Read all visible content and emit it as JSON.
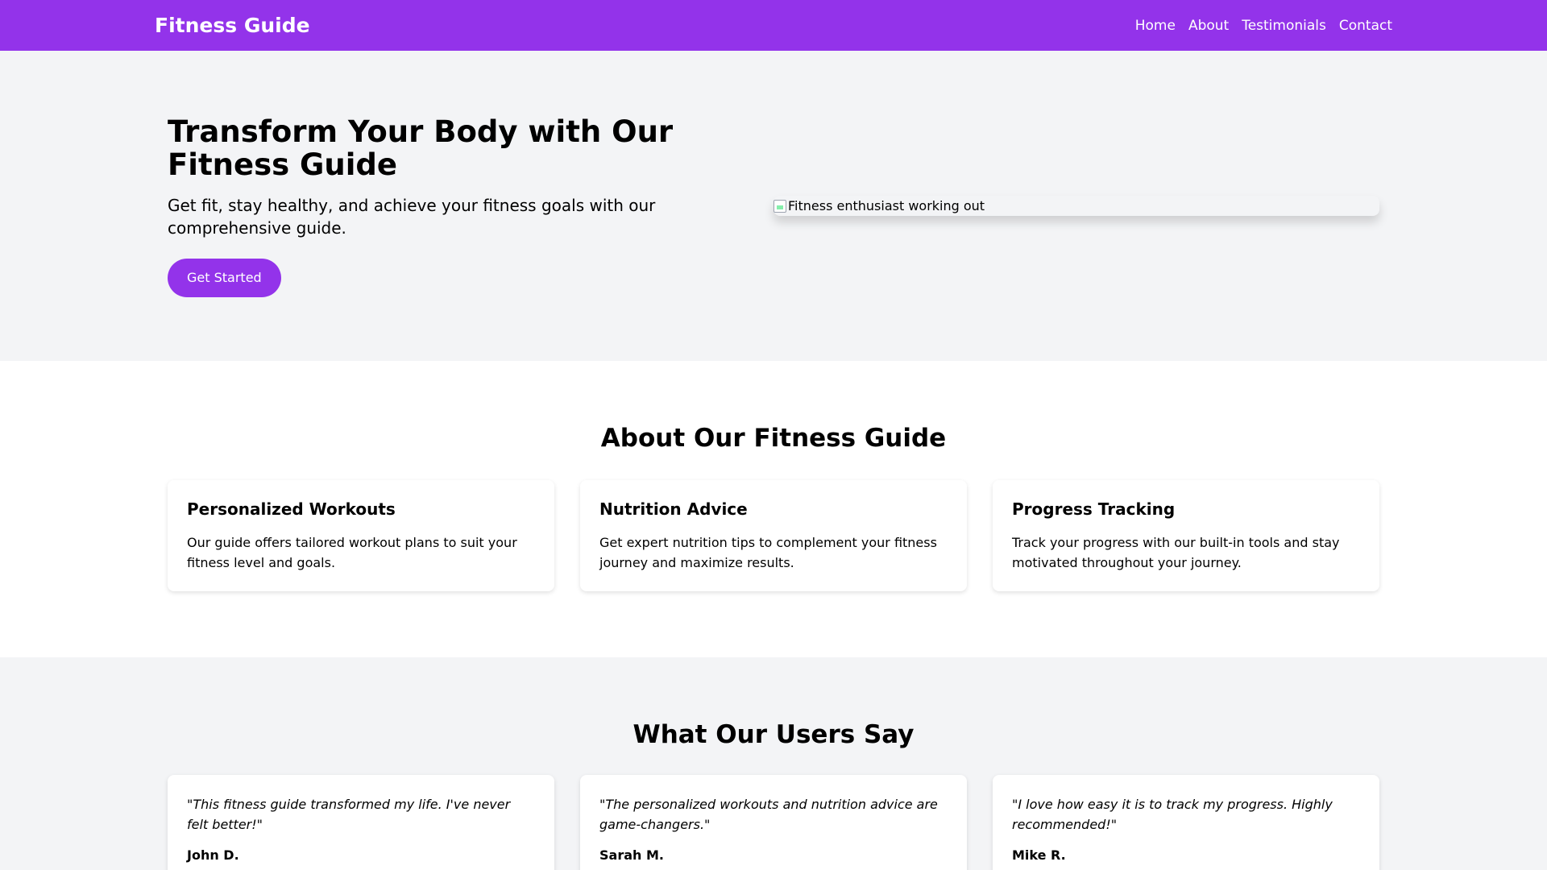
{
  "nav": {
    "brand": "Fitness Guide",
    "links": [
      "Home",
      "About",
      "Testimonials",
      "Contact"
    ]
  },
  "hero": {
    "title": "Transform Your Body with Our Fitness Guide",
    "subtitle": "Get fit, stay healthy, and achieve your fitness goals with our comprehensive guide.",
    "cta_label": "Get Started",
    "image_alt": "Fitness enthusiast working out"
  },
  "about": {
    "title": "About Our Fitness Guide",
    "cards": [
      {
        "title": "Personalized Workouts",
        "text": "Our guide offers tailored workout plans to suit your fitness level and goals."
      },
      {
        "title": "Nutrition Advice",
        "text": "Get expert nutrition tips to complement your fitness journey and maximize results."
      },
      {
        "title": "Progress Tracking",
        "text": "Track your progress with our built-in tools and stay motivated throughout your journey."
      }
    ]
  },
  "testimonials": {
    "title": "What Our Users Say",
    "items": [
      {
        "quote": "\"This fitness guide transformed my life. I've never felt better!\"",
        "author": "John D."
      },
      {
        "quote": "\"The personalized workouts and nutrition advice are game-changers.\"",
        "author": "Sarah M."
      },
      {
        "quote": "\"I love how easy it is to track my progress. Highly recommended!\"",
        "author": "Mike R."
      }
    ]
  },
  "colors": {
    "accent": "#9333ea",
    "page_background": "#f3f4f6",
    "section_background": "#ffffff"
  }
}
